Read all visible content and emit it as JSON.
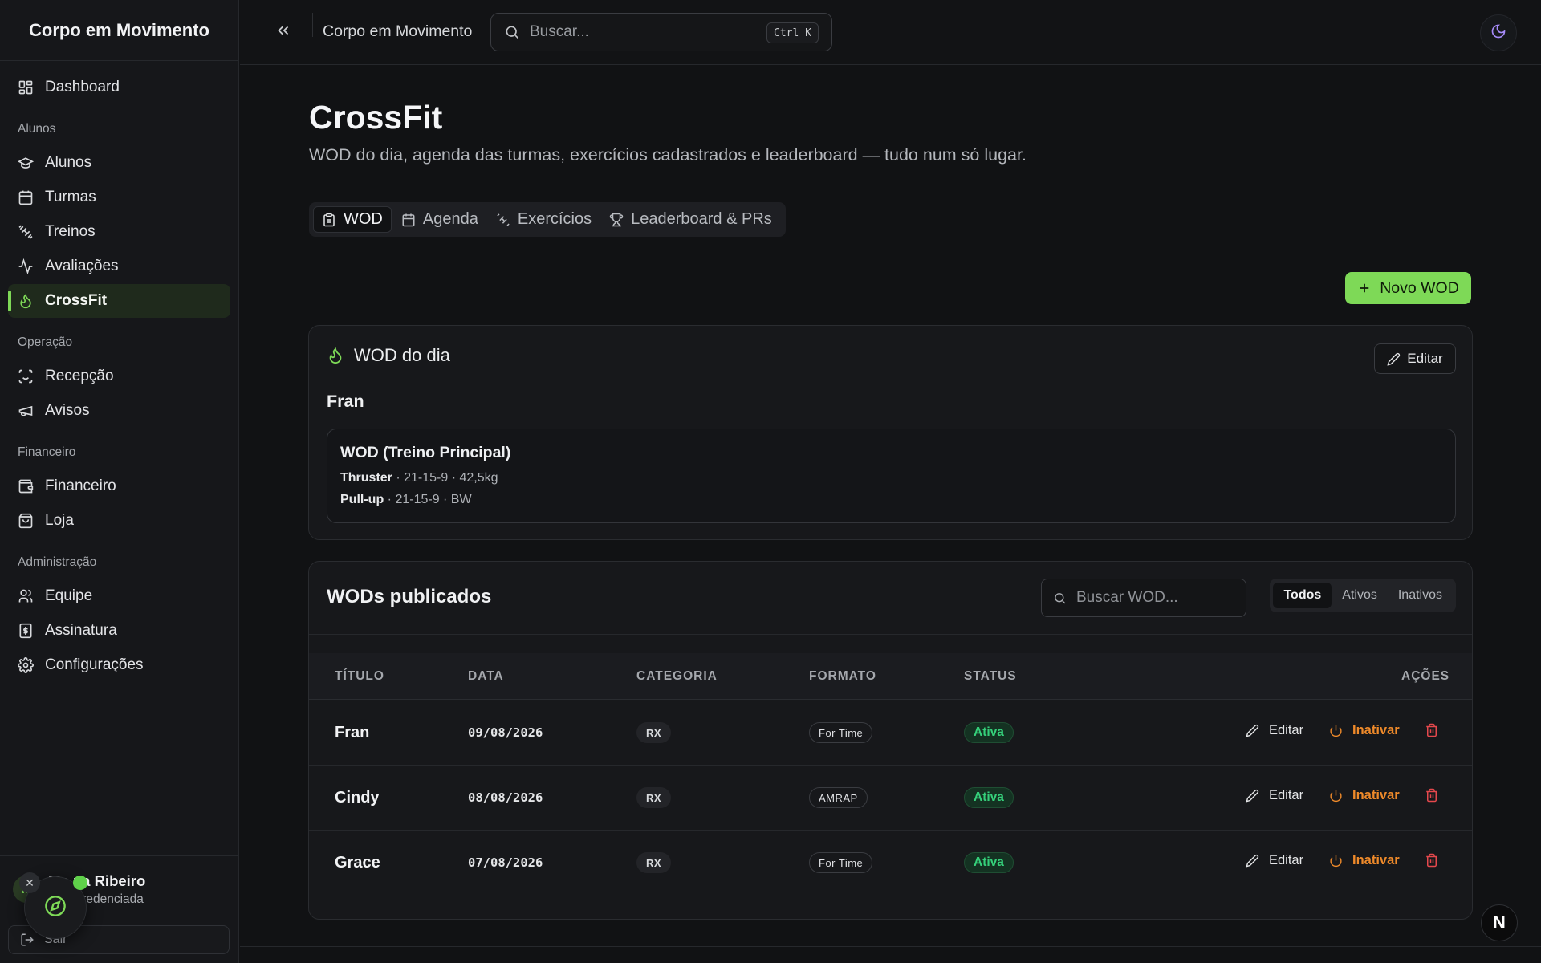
{
  "brand": "Corpo em Movimento",
  "sidebar": {
    "top": [
      {
        "label": "Dashboard",
        "icon": "dashboard-icon"
      }
    ],
    "groups": [
      {
        "label": "Alunos",
        "items": [
          {
            "label": "Alunos",
            "icon": "graduation-cap-icon"
          },
          {
            "label": "Turmas",
            "icon": "calendar-icon"
          },
          {
            "label": "Treinos",
            "icon": "dumbbell-icon"
          },
          {
            "label": "Avaliações",
            "icon": "activity-icon"
          },
          {
            "label": "CrossFit",
            "icon": "flame-icon",
            "active": true
          }
        ]
      },
      {
        "label": "Operação",
        "items": [
          {
            "label": "Recepção",
            "icon": "scan-face-icon"
          },
          {
            "label": "Avisos",
            "icon": "megaphone-icon"
          }
        ]
      },
      {
        "label": "Financeiro",
        "items": [
          {
            "label": "Financeiro",
            "icon": "wallet-icon"
          },
          {
            "label": "Loja",
            "icon": "shopping-bag-icon"
          }
        ]
      },
      {
        "label": "Administração",
        "items": [
          {
            "label": "Equipe",
            "icon": "users-icon"
          },
          {
            "label": "Assinatura",
            "icon": "receipt-icon"
          },
          {
            "label": "Configurações",
            "icon": "gear-icon"
          }
        ]
      }
    ],
    "user": {
      "initials": "M",
      "name": "Ma    na Ribeiro",
      "role": "   r de Credenciada"
    },
    "logout_label": "Sair"
  },
  "header": {
    "title": "Corpo em Movimento",
    "search_placeholder": "Buscar...",
    "shortcut": "Ctrl K"
  },
  "page": {
    "title": "CrossFit",
    "subtitle": "WOD do dia, agenda das turmas, exercícios cadastrados e leaderboard — tudo num só lugar.",
    "tabs": [
      {
        "label": "WOD",
        "active": true
      },
      {
        "label": "Agenda"
      },
      {
        "label": "Exercícios"
      },
      {
        "label": "Leaderboard & PRs"
      }
    ],
    "new_wod_label": "Novo WOD"
  },
  "wod_card": {
    "heading": "WOD do dia",
    "edit_label": "Editar",
    "name": "Fran",
    "block_title": "WOD (Treino Principal)",
    "exercises": [
      {
        "name": "Thruster",
        "detail": " · 21-15-9 · 42,5kg"
      },
      {
        "name": "Pull-up",
        "detail": " · 21-15-9 · BW"
      }
    ]
  },
  "list": {
    "title": "WODs publicados",
    "search_placeholder": "Buscar WOD...",
    "filters": [
      {
        "label": "Todos",
        "active": true
      },
      {
        "label": "Ativos"
      },
      {
        "label": "Inativos"
      }
    ],
    "columns": [
      "TÍTULO",
      "DATA",
      "CATEGORIA",
      "FORMATO",
      "STATUS",
      "AÇÕES"
    ],
    "rows": [
      {
        "title": "Fran",
        "date": "09/08/2026",
        "category": "RX",
        "format": "For Time",
        "status": "Ativa"
      },
      {
        "title": "Cindy",
        "date": "08/08/2026",
        "category": "RX",
        "format": "AMRAP",
        "status": "Ativa"
      },
      {
        "title": "Grace",
        "date": "07/08/2026",
        "category": "RX",
        "format": "For Time",
        "status": "Ativa"
      }
    ],
    "action_edit": "Editar",
    "action_inactivate": "Inativar"
  },
  "colors": {
    "accent": "#7ed957",
    "status_active": "#35d07a",
    "warning": "#ef8a2a",
    "danger": "#e5484d"
  },
  "badge": "N"
}
